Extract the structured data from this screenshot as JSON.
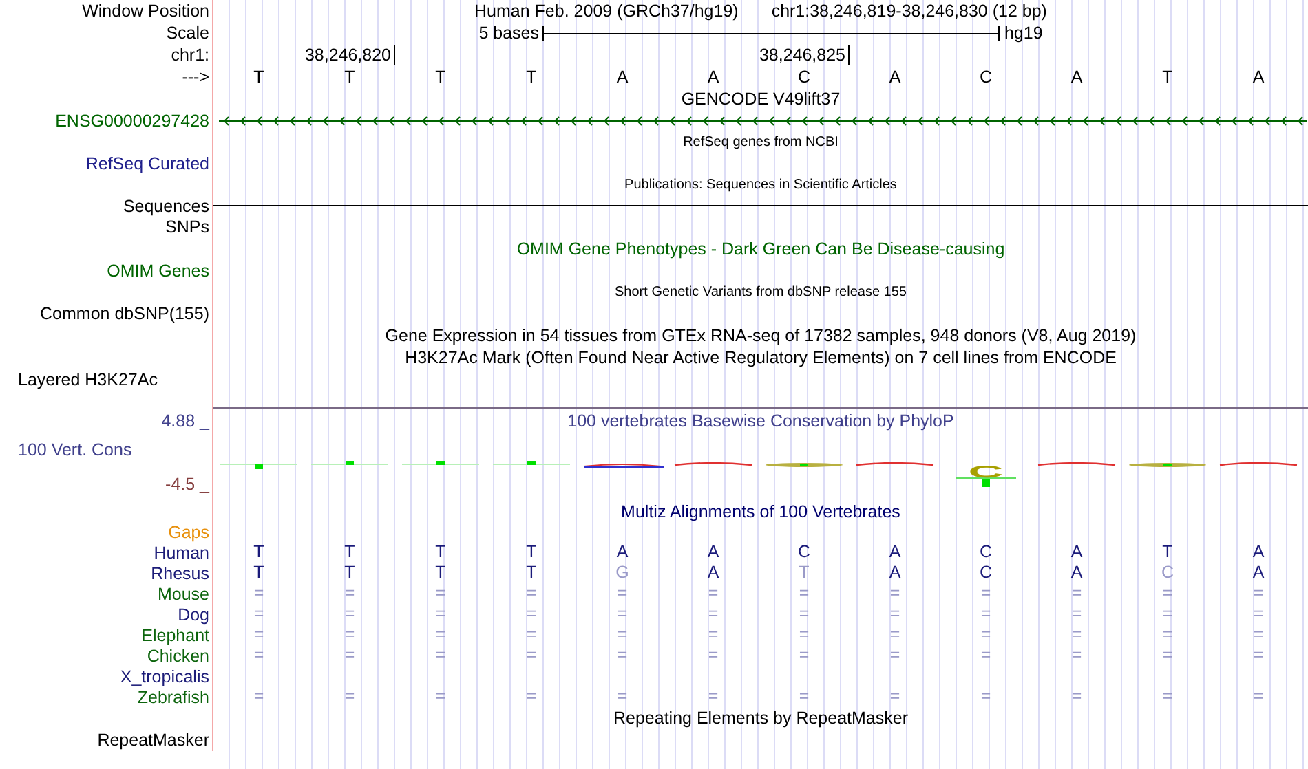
{
  "header": {
    "label": "Window Position",
    "assembly": "Human Feb. 2009 (GRCh37/hg19)",
    "position": "chr1:38,246,819-38,246,830 (12 bp)"
  },
  "scale": {
    "label": "Scale",
    "bar_label": "5 bases",
    "assembly": "hg19"
  },
  "ruler": {
    "label": "chr1:"
  },
  "sequence": {
    "label": "--->",
    "bases": [
      {
        "letter": "T"
      },
      {
        "letter": "T",
        "tick": "38,246,820"
      },
      {
        "letter": "T"
      },
      {
        "letter": "T"
      },
      {
        "letter": "A"
      },
      {
        "letter": "A"
      },
      {
        "letter": "C",
        "tick": "38,246,825"
      },
      {
        "letter": "A"
      },
      {
        "letter": "C"
      },
      {
        "letter": "A"
      },
      {
        "letter": "T"
      },
      {
        "letter": "A"
      }
    ]
  },
  "tracks": [
    {
      "kind": "gene",
      "title": {
        "text": "GENCODE V49lift37",
        "color": "#000000"
      },
      "label": {
        "text": "ENSG00000297428",
        "color": "#006400"
      },
      "reverse_strand": true
    },
    {
      "kind": "compact",
      "title": {
        "text": "RefSeq genes from NCBI",
        "color": "#000000"
      },
      "label": {
        "text": "RefSeq Curated",
        "color": "#20208c"
      }
    },
    {
      "kind": "line",
      "title": {
        "text": "Publications: Sequences in Scientific Articles",
        "color": "#000000"
      },
      "label": {
        "text": "Sequences",
        "color": "#000000"
      }
    },
    {
      "kind": "label-only",
      "label": {
        "text": "SNPs",
        "color": "#000000"
      }
    },
    {
      "kind": "plain",
      "title": {
        "text": "OMIM Gene Phenotypes - Dark Green Can Be Disease-causing",
        "color": "#006400"
      },
      "label": {
        "text": "OMIM Genes",
        "color": "#006400"
      }
    },
    {
      "kind": "compact",
      "title": {
        "text": "Short Genetic Variants from dbSNP release 155",
        "color": "#000000"
      },
      "label": {
        "text": "Common dbSNP(155)",
        "color": "#000000"
      }
    },
    {
      "kind": "plain",
      "title": {
        "text": "Gene Expression in 54 tissues from GTEx RNA-seq of 17382 samples, 948 donors (V8, Aug 2019)",
        "color": "#000000"
      }
    },
    {
      "kind": "composite",
      "title": {
        "text": "H3K27Ac Mark (Often Found Near Active Regulatory Elements) on 7 cell lines from ENCODE",
        "color": "#000000"
      },
      "label": {
        "text": "Layered H3K27Ac",
        "color": "#000000"
      }
    },
    {
      "kind": "wiggle",
      "title": {
        "text": "100 vertebrates Basewise Conservation by PhyloP",
        "color": "#40408c"
      },
      "label": {
        "text": "100 Vert. Cons",
        "color": "#40408c"
      },
      "y_max": {
        "text": "4.88 _",
        "color": "#40408c"
      },
      "y_min": {
        "text": "-4.5 _",
        "color": "#843c3c"
      },
      "logo_letter": "C"
    },
    {
      "kind": "multiz",
      "title": {
        "text": "Multiz Alignments of 100 Vertebrates",
        "color": "#00006e"
      },
      "species": [
        {
          "name": "Gaps",
          "color": "#e8900c"
        },
        {
          "name": "Human",
          "color": "#1c1c78",
          "cells": [
            {
              "text": "T",
              "dim": false
            },
            {
              "text": "T",
              "dim": false
            },
            {
              "text": "T",
              "dim": false
            },
            {
              "text": "T",
              "dim": false
            },
            {
              "text": "A",
              "dim": false
            },
            {
              "text": "A",
              "dim": false
            },
            {
              "text": "C",
              "dim": false
            },
            {
              "text": "A",
              "dim": false
            },
            {
              "text": "C",
              "dim": false
            },
            {
              "text": "A",
              "dim": false
            },
            {
              "text": "T",
              "dim": false
            },
            {
              "text": "A",
              "dim": false
            }
          ]
        },
        {
          "name": "Rhesus",
          "color": "#1c1c78",
          "cells": [
            {
              "text": "T",
              "dim": false
            },
            {
              "text": "T",
              "dim": false
            },
            {
              "text": "T",
              "dim": false
            },
            {
              "text": "T",
              "dim": false
            },
            {
              "text": "G",
              "dim": true
            },
            {
              "text": "A",
              "dim": false
            },
            {
              "text": "T",
              "dim": true
            },
            {
              "text": "A",
              "dim": false
            },
            {
              "text": "C",
              "dim": false
            },
            {
              "text": "A",
              "dim": false
            },
            {
              "text": "C",
              "dim": true
            },
            {
              "text": "A",
              "dim": false
            }
          ]
        },
        {
          "name": "Mouse",
          "color": "#0c640c",
          "cells": [
            {
              "text": "=",
              "dim": true
            },
            {
              "text": "=",
              "dim": true
            },
            {
              "text": "=",
              "dim": true
            },
            {
              "text": "=",
              "dim": true
            },
            {
              "text": "=",
              "dim": true
            },
            {
              "text": "=",
              "dim": true
            },
            {
              "text": "=",
              "dim": true
            },
            {
              "text": "=",
              "dim": true
            },
            {
              "text": "=",
              "dim": true
            },
            {
              "text": "=",
              "dim": true
            },
            {
              "text": "=",
              "dim": true
            },
            {
              "text": "=",
              "dim": true
            }
          ]
        },
        {
          "name": "Dog",
          "color": "#1c1c78",
          "cells": [
            {
              "text": "=",
              "dim": true
            },
            {
              "text": "=",
              "dim": true
            },
            {
              "text": "=",
              "dim": true
            },
            {
              "text": "=",
              "dim": true
            },
            {
              "text": "=",
              "dim": true
            },
            {
              "text": "=",
              "dim": true
            },
            {
              "text": "=",
              "dim": true
            },
            {
              "text": "=",
              "dim": true
            },
            {
              "text": "=",
              "dim": true
            },
            {
              "text": "=",
              "dim": true
            },
            {
              "text": "=",
              "dim": true
            },
            {
              "text": "=",
              "dim": true
            }
          ]
        },
        {
          "name": "Elephant",
          "color": "#0c640c",
          "cells": [
            {
              "text": "=",
              "dim": true
            },
            {
              "text": "=",
              "dim": true
            },
            {
              "text": "=",
              "dim": true
            },
            {
              "text": "=",
              "dim": true
            },
            {
              "text": "=",
              "dim": true
            },
            {
              "text": "=",
              "dim": true
            },
            {
              "text": "=",
              "dim": true
            },
            {
              "text": "=",
              "dim": true
            },
            {
              "text": "=",
              "dim": true
            },
            {
              "text": "=",
              "dim": true
            },
            {
              "text": "=",
              "dim": true
            },
            {
              "text": "=",
              "dim": true
            }
          ]
        },
        {
          "name": "Chicken",
          "color": "#0c640c",
          "cells": [
            {
              "text": "=",
              "dim": true
            },
            {
              "text": "=",
              "dim": true
            },
            {
              "text": "=",
              "dim": true
            },
            {
              "text": "=",
              "dim": true
            },
            {
              "text": "=",
              "dim": true
            },
            {
              "text": "=",
              "dim": true
            },
            {
              "text": "=",
              "dim": true
            },
            {
              "text": "=",
              "dim": true
            },
            {
              "text": "=",
              "dim": true
            },
            {
              "text": "=",
              "dim": true
            },
            {
              "text": "=",
              "dim": true
            },
            {
              "text": "=",
              "dim": true
            }
          ]
        },
        {
          "name": "X_tropicalis",
          "color": "#1c1c78"
        },
        {
          "name": "Zebrafish",
          "color": "#0c640c",
          "cells": [
            {
              "text": "=",
              "dim": true
            },
            {
              "text": "=",
              "dim": true
            },
            {
              "text": "=",
              "dim": true
            },
            {
              "text": "=",
              "dim": true
            },
            {
              "text": "=",
              "dim": true
            },
            {
              "text": "=",
              "dim": true
            },
            {
              "text": "=",
              "dim": true
            },
            {
              "text": "=",
              "dim": true
            },
            {
              "text": "=",
              "dim": true
            },
            {
              "text": "=",
              "dim": true
            },
            {
              "text": "=",
              "dim": true
            },
            {
              "text": "=",
              "dim": true
            }
          ]
        }
      ]
    },
    {
      "kind": "plain",
      "title": {
        "text": "Repeating Elements by RepeatMasker",
        "color": "#000000"
      },
      "label": {
        "text": "RepeatMasker",
        "color": "#000000"
      }
    }
  ]
}
